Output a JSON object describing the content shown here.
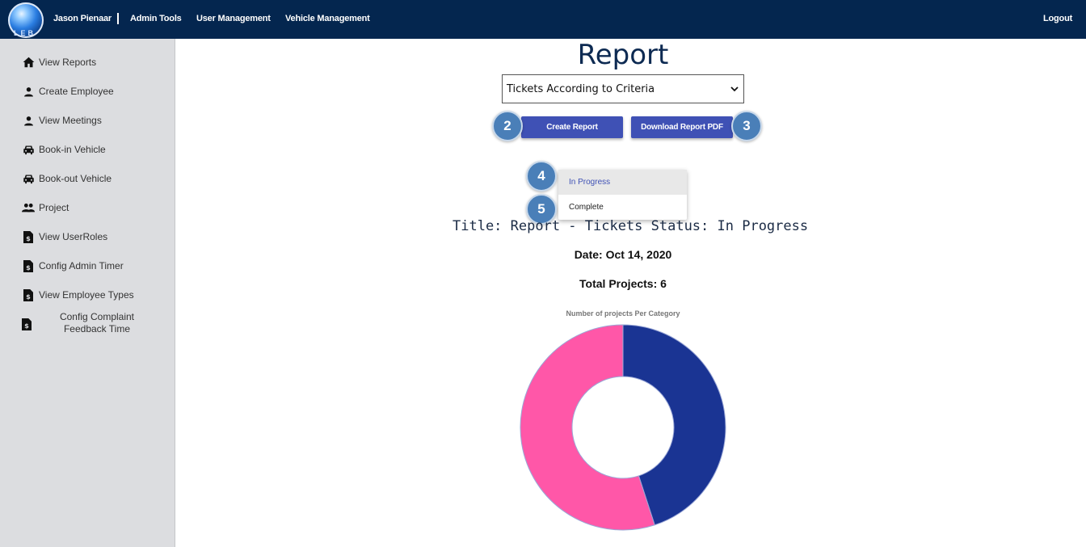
{
  "nav": {
    "user": "Jason Pienaar",
    "separator": "|",
    "admin_tools": "Admin Tools",
    "user_management": "User Management",
    "vehicle_management": "Vehicle Management",
    "logout": "Logout",
    "logo_text": "LEB"
  },
  "sidebar": {
    "items": [
      {
        "label": "View Reports",
        "icon": "home-icon"
      },
      {
        "label": "Create Employee",
        "icon": "person-icon"
      },
      {
        "label": "View Meetings",
        "icon": "person-icon"
      },
      {
        "label": "Book-in Vehicle",
        "icon": "car-icon"
      },
      {
        "label": "Book-out Vehicle",
        "icon": "car-icon"
      },
      {
        "label": "Project",
        "icon": "group-icon"
      },
      {
        "label": "View UserRoles",
        "icon": "document-icon"
      },
      {
        "label": "Config Admin Timer",
        "icon": "document-icon"
      },
      {
        "label": "View Employee Types",
        "icon": "document-icon"
      },
      {
        "label": "Config Complaint Feedback Time",
        "icon": "document-icon"
      }
    ]
  },
  "main": {
    "title": "Report",
    "select_value": "Tickets According to Criteria",
    "create_button": "Create Report",
    "download_button": "Download Report PDF",
    "callouts": [
      "2",
      "3",
      "4",
      "5"
    ],
    "menu_items": [
      "In Progress",
      "Complete"
    ],
    "report_title": "Title: Report - Tickets Status: In Progress",
    "report_date": "Date: Oct 14, 2020",
    "report_total": "Total Projects: 6"
  },
  "colors": {
    "nav_bg": "#04264f",
    "sidebar_bg": "#dcdde0",
    "button": "#3f51b5",
    "callout": "#4a7fb8"
  },
  "chart_data": {
    "type": "pie",
    "title": "Number of projects Per Category",
    "slices": [
      {
        "value": 45,
        "color": "#1a3493"
      },
      {
        "value": 55,
        "color": "#ff57a8"
      }
    ],
    "donut": true
  }
}
